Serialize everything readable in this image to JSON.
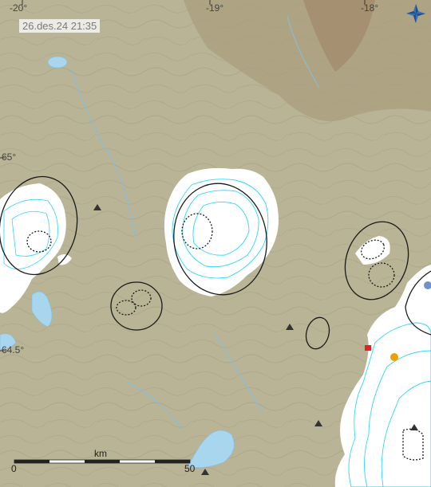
{
  "timestamp": "26.des.24  21:35",
  "longitude_labels": [
    "-20°",
    "-19°",
    "-18°"
  ],
  "latitude_labels": [
    "65°",
    "64.5°"
  ],
  "scale": {
    "title": "km",
    "start": "0",
    "end": "50"
  },
  "icons": {
    "compass": "compass-icon"
  },
  "markers": [
    {
      "name": "station-marker",
      "shape": "triangle",
      "color": "#333333"
    },
    {
      "name": "earthquake-red",
      "shape": "square",
      "color": "#e8201e"
    },
    {
      "name": "earthquake-orange",
      "shape": "circle",
      "color": "#f0a000"
    },
    {
      "name": "earthquake-blue",
      "shape": "circle",
      "color": "#6f92c8"
    }
  ],
  "colors": {
    "land": "#b9b495",
    "glacier": "#ffffff",
    "water": "#a7d6ee",
    "contour": "#8c8672",
    "glacier_contour": "#2fd7ff"
  }
}
